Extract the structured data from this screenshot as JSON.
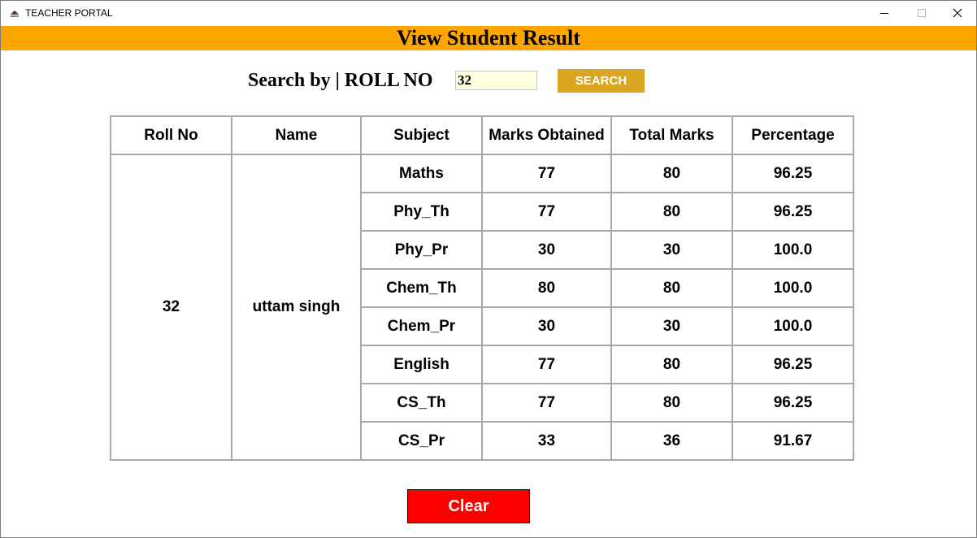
{
  "window": {
    "title": "TEACHER PORTAL",
    "icon": "app-logo-icon",
    "controls": {
      "minimize": "minimize-icon",
      "maximize": "maximize-icon",
      "close": "close-icon"
    }
  },
  "banner": {
    "title": "View Student Result",
    "color": "#ffa500"
  },
  "search": {
    "label": "Search by | ROLL NO",
    "value": "32",
    "button_label": "SEARCH",
    "button_color": "#daa520",
    "input_bg": "#ffffe0"
  },
  "table": {
    "headers": [
      "Roll No",
      "Name",
      "Subject",
      "Marks Obtained",
      "Total Marks",
      "Percentage"
    ],
    "roll_no": "32",
    "name": "uttam singh",
    "rows": [
      {
        "subject": "Maths",
        "marks": "77",
        "total": "80",
        "percentage": "96.25"
      },
      {
        "subject": "Phy_Th",
        "marks": "77",
        "total": "80",
        "percentage": "96.25"
      },
      {
        "subject": "Phy_Pr",
        "marks": "30",
        "total": "30",
        "percentage": "100.0"
      },
      {
        "subject": "Chem_Th",
        "marks": "80",
        "total": "80",
        "percentage": "100.0"
      },
      {
        "subject": "Chem_Pr",
        "marks": "30",
        "total": "30",
        "percentage": "100.0"
      },
      {
        "subject": "English",
        "marks": "77",
        "total": "80",
        "percentage": "96.25"
      },
      {
        "subject": "CS_Th",
        "marks": "77",
        "total": "80",
        "percentage": "96.25"
      },
      {
        "subject": "CS_Pr",
        "marks": "33",
        "total": "36",
        "percentage": "91.67"
      }
    ]
  },
  "clear_button": {
    "label": "Clear",
    "color": "#ff0000"
  }
}
